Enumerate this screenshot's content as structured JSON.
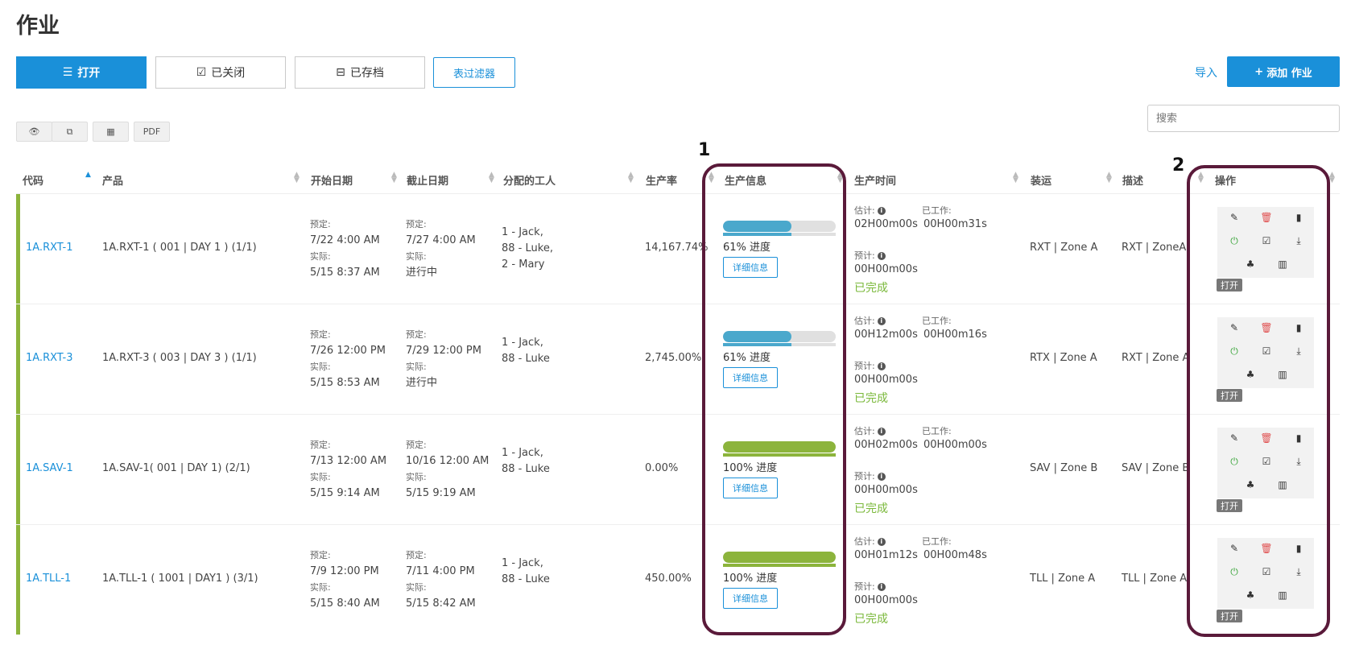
{
  "page": {
    "title": "作业"
  },
  "tabs": [
    {
      "label": "打开",
      "icon": "list-icon",
      "active": true
    },
    {
      "label": "已关闭",
      "icon": "check-square-icon",
      "active": false
    },
    {
      "label": "已存档",
      "icon": "inbox-icon",
      "active": false
    }
  ],
  "filter_label": "表过滤器",
  "import_label": "导入",
  "add_label": "添加 作业",
  "search_placeholder": "搜索",
  "tools": {
    "view": "eye-icon",
    "copy": "copy-icon",
    "table": "table-icon",
    "pdf": "PDF"
  },
  "columns": [
    "代码",
    "产品",
    "开始日期",
    "截止日期",
    "分配的工人",
    "生产率",
    "生产信息",
    "生产时间",
    "装运",
    "描述",
    "操作"
  ],
  "labels": {
    "scheduled": "预定:",
    "actual": "实际:",
    "estimate": "估计:",
    "worked": "已工作:",
    "forecast": "预计:",
    "detail": "详细信息",
    "open": "打开",
    "progress_suffix": "进度"
  },
  "callouts": [
    "1",
    "2"
  ],
  "rows": [
    {
      "code": "1A.RXT-1",
      "product": "1A.RXT-1 ( 001 | DAY 1 ) (1/1)",
      "start_sched": "7/22   4:00 AM",
      "start_actual": "5/15   8:37 AM",
      "end_sched": "7/27   4:00 AM",
      "end_actual": "进行中",
      "workers": [
        "1 - Jack,",
        "88 - Luke,",
        "2 - Mary"
      ],
      "rate": "14,167.74%",
      "progress": 0.61,
      "progress_label": "61% 进度",
      "progress_color": "#4aa8cc",
      "estimate": "02H00m00s",
      "worked": "00H00m31s",
      "forecast": "00H00m00s",
      "status": "已完成",
      "shipping": "RXT | Zone A",
      "description": "RXT | ZoneA"
    },
    {
      "code": "1A.RXT-3",
      "product": "1A.RXT-3 ( 003 | DAY 3 ) (1/1)",
      "start_sched": "7/26   12:00 PM",
      "start_actual": "5/15   8:53 AM",
      "end_sched": "7/29   12:00 PM",
      "end_actual": "进行中",
      "workers": [
        "1 - Jack,",
        "88 - Luke"
      ],
      "rate": "2,745.00%",
      "progress": 0.61,
      "progress_label": "61% 进度",
      "progress_color": "#4aa8cc",
      "estimate": "00H12m00s",
      "worked": "00H00m16s",
      "forecast": "00H00m00s",
      "status": "已完成",
      "shipping": "RTX | Zone A",
      "description": "RXT | Zone A"
    },
    {
      "code": "1A.SAV-1",
      "product": "1A.SAV-1( 001 | DAY 1) (2/1)",
      "start_sched": "7/13   12:00 AM",
      "start_actual": "5/15   9:14 AM",
      "end_sched": "10/16   12:00 AM",
      "end_actual": "5/15   9:19 AM",
      "workers": [
        "1 - Jack,",
        "88 - Luke"
      ],
      "rate": "0.00%",
      "progress": 1.0,
      "progress_label": "100% 进度",
      "progress_color": "#8cb43c",
      "estimate": "00H02m00s",
      "worked": "00H00m00s",
      "forecast": "00H00m00s",
      "status": "已完成",
      "shipping": "SAV | Zone B",
      "description": "SAV | Zone B"
    },
    {
      "code": "1A.TLL-1",
      "product": "1A.TLL-1 ( 1001 | DAY1 ) (3/1)",
      "start_sched": "7/9   12:00 PM",
      "start_actual": "5/15   8:40 AM",
      "end_sched": "7/11   4:00 PM",
      "end_actual": "5/15   8:42 AM",
      "workers": [
        "1 - Jack,",
        "88 - Luke"
      ],
      "rate": "450.00%",
      "progress": 1.0,
      "progress_label": "100% 进度",
      "progress_color": "#8cb43c",
      "estimate": "00H01m12s",
      "worked": "00H00m48s",
      "forecast": "00H00m00s",
      "status": "已完成",
      "shipping": "TLL | Zone A",
      "description": "TLL | Zone A"
    }
  ]
}
